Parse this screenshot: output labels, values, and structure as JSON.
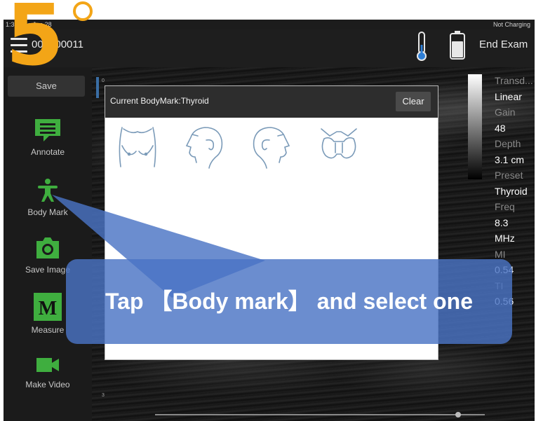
{
  "status_bar": {
    "time": "1:38",
    "date": "Sun Jun 28",
    "battery_status": "Not Charging"
  },
  "header": {
    "exam_id": "000000011",
    "end_exam_label": "End Exam"
  },
  "sidebar": {
    "save_label": "Save",
    "tools": [
      {
        "label": "Annotate",
        "icon": "annotate-icon"
      },
      {
        "label": "Body Mark",
        "icon": "body-mark-icon"
      },
      {
        "label": "Save Image",
        "icon": "camera-icon"
      },
      {
        "label": "Measure",
        "icon": "measure-icon"
      },
      {
        "label": "Make Video",
        "icon": "video-icon"
      }
    ]
  },
  "scale": {
    "tick_top": "0",
    "tick_bottom": "3"
  },
  "params": [
    {
      "label": "Transd...",
      "value": "Linear"
    },
    {
      "label": "Gain",
      "value": "48"
    },
    {
      "label": "Depth",
      "value": "3.1 cm"
    },
    {
      "label": "Preset",
      "value": "Thyroid"
    },
    {
      "label": "Freq",
      "value": "8.3"
    },
    {
      "value": "MHz"
    },
    {
      "label": "MI",
      "value": "0.54"
    },
    {
      "label": "TI",
      "value": "0.56"
    }
  ],
  "body_mark_dialog": {
    "title": "Current BodyMark:Thyroid",
    "clear_label": "Clear",
    "marks": [
      "breast-icon",
      "head-left-icon",
      "head-right-icon",
      "thyroid-icon"
    ]
  },
  "tutorial": {
    "step": "5",
    "instruction": "Tap 【Body mark】 and select one"
  },
  "colors": {
    "accent_green": "#3fae3f",
    "step_orange": "#f3a517",
    "banner_blue": "#4a74c4"
  }
}
